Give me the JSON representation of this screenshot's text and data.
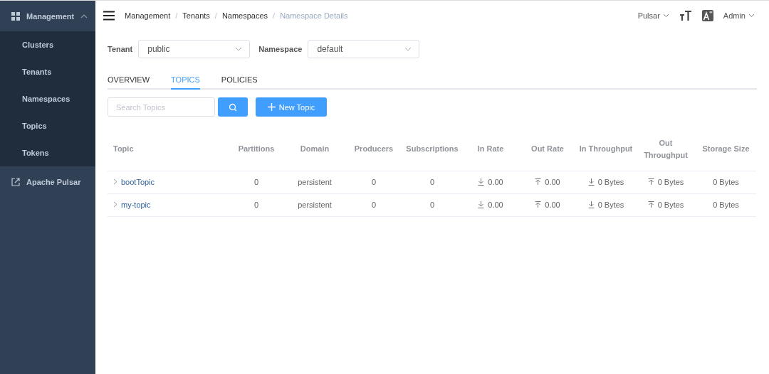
{
  "sidebar": {
    "group": {
      "label": "Management",
      "expanded": true,
      "children": [
        {
          "label": "Clusters",
          "selected": false
        },
        {
          "label": "Tenants",
          "selected": false
        },
        {
          "label": "Namespaces",
          "selected": false
        },
        {
          "label": "Topics",
          "selected": false
        },
        {
          "label": "Tokens",
          "selected": false
        }
      ]
    },
    "link": {
      "label": "Apache Pulsar"
    }
  },
  "breadcrumb_separator": "/",
  "breadcrumb": [
    {
      "label": "Management",
      "current": false
    },
    {
      "label": "Tenants",
      "current": false
    },
    {
      "label": "Namespaces",
      "current": false
    },
    {
      "label": "Namespace Details",
      "current": true
    }
  ],
  "header_right": {
    "cluster": "Pulsar",
    "user": "Admin"
  },
  "filters": [
    {
      "label": "Tenant",
      "value": "public"
    },
    {
      "label": "Namespace",
      "value": "default"
    }
  ],
  "tabs": [
    {
      "label": "OVERVIEW",
      "selected": false
    },
    {
      "label": "TOPICS",
      "selected": true
    },
    {
      "label": "POLICIES",
      "selected": false
    }
  ],
  "search": {
    "placeholder": "Search Topics"
  },
  "new_button": {
    "label": "New Topic"
  },
  "table": {
    "columns": [
      {
        "label": "Topic",
        "kind": "topic"
      },
      {
        "label": "Partitions",
        "kind": "plain"
      },
      {
        "label": "Domain",
        "kind": "plain"
      },
      {
        "label": "Producers",
        "kind": "plain"
      },
      {
        "label": "Subscriptions",
        "kind": "plain"
      },
      {
        "label": "In Rate",
        "kind": "in"
      },
      {
        "label": "Out Rate",
        "kind": "out"
      },
      {
        "label": "In Throughput",
        "kind": "in"
      },
      {
        "label": "Out Throughput",
        "kind": "out"
      },
      {
        "label": "Storage Size",
        "kind": "plain"
      }
    ],
    "rows": [
      {
        "expanded": false,
        "cells": [
          "bootTopic",
          "0",
          "persistent",
          "0",
          "0",
          "0.00",
          "0.00",
          "0 Bytes",
          "0 Bytes",
          "0 Bytes"
        ]
      },
      {
        "expanded": false,
        "cells": [
          "my-topic",
          "0",
          "persistent",
          "0",
          "0",
          "0.00",
          "0.00",
          "0 Bytes",
          "0 Bytes",
          "0 Bytes"
        ]
      }
    ]
  }
}
